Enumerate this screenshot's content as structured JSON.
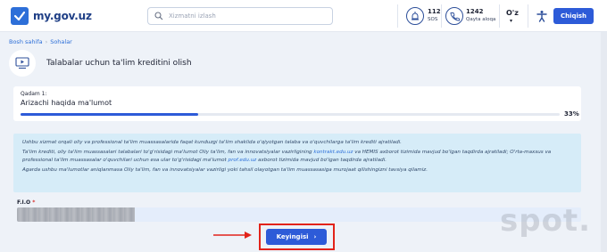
{
  "header": {
    "logo_text": "my.gov.uz",
    "search_placeholder": "Xizmatni izlash",
    "sos": {
      "number": "112",
      "label": "SOS"
    },
    "callback": {
      "number": "1242",
      "label": "Qayta aloqa"
    },
    "language": "O'z",
    "login_label": "Chiqish"
  },
  "breadcrumb": {
    "home": "Bosh sahifa",
    "current": "Sohalar"
  },
  "page_title": "Talabalar uchun ta'lim kreditini olish",
  "step": {
    "label": "Qadam 1:",
    "title": "Arizachi haqida ma'lumot",
    "progress": 0.33,
    "percent_text": "33%"
  },
  "info": {
    "p1": "Ushbu xizmat orqali oliy va professional ta'lim muassasalarida faqat kunduzgi ta'lim shaklida o'qiyotgan talaba va o'quvchilarga ta'lim krediti ajratiladi.",
    "p2_a": "Ta'lim krediti, oliy ta'lim muassasalari talabalari to'g'risidagi ma'lumot Oliy ta'lim, fan va innovatsiyalar vazirligining ",
    "p2_link1": "kontrakt.edu.uz",
    "p2_b": " va HEMIS axborot tizimida mavjud bo'lgan taqdirda ajratiladi; O'rta-maxsus va professional ta'lim muassasalar o'quvchilari uchun esa ular to'g'risidagi ma'lumot ",
    "p2_link2": "prof.edu.uz",
    "p2_c": " axborot tizimida mavjud bo'lgan taqdirda ajratiladi.",
    "p3": "Agarda ushbu ma'lumotlar aniqlanmasa Oliy ta'lim, fan va innovatsiyalar vazirligi yoki tahsil olayotgan ta'lim muassasasiga murojaat qilishingizni tavsiya qilamiz."
  },
  "form": {
    "fio_label": "F.I.O",
    "required_mark": "*"
  },
  "next_button": {
    "label": "Keyingisi",
    "chevron": "›"
  },
  "watermark": "spot.",
  "colors": {
    "primary": "#2d5bd8",
    "highlight": "#e2231a",
    "info_bg": "#d6ecf8"
  }
}
